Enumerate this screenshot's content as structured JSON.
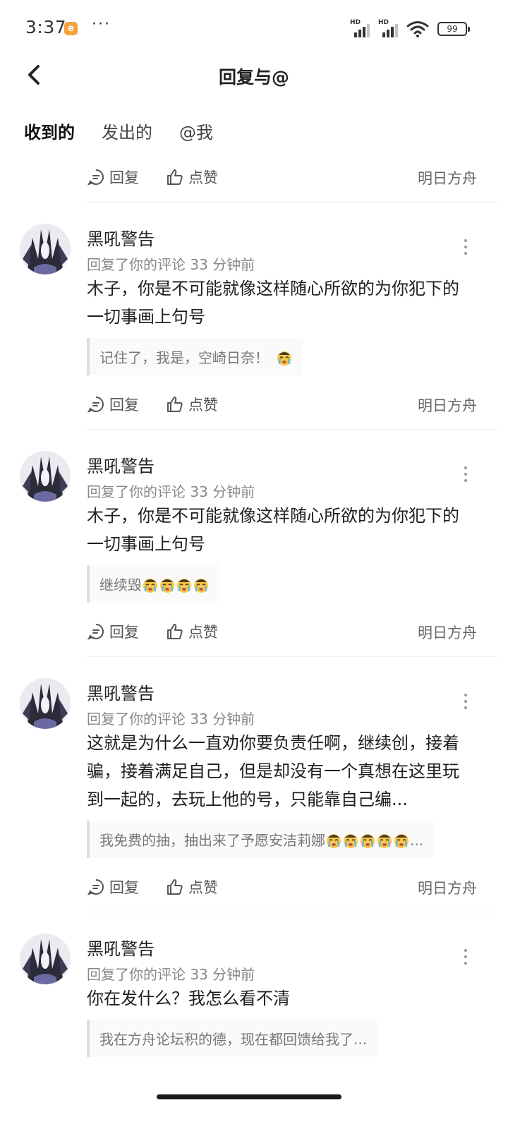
{
  "status_bar": {
    "time": "3:37",
    "app_badge": "e",
    "more": "···",
    "signal_1_label": "HD",
    "signal_2_label": "HD",
    "battery": "99"
  },
  "header": {
    "title": "回复与@"
  },
  "tabs": [
    {
      "label": "收到的",
      "active": true
    },
    {
      "label": "发出的",
      "active": false
    },
    {
      "label": "@我",
      "active": false
    }
  ],
  "top_actions": {
    "reply": "回复",
    "like": "点赞",
    "source": "明日方舟"
  },
  "items": [
    {
      "username": "黑吼警告",
      "meta": "回复了你的评论 33 分钟前",
      "text": "木子，你是不可能就像这样随心所欲的为你犯下的一切事画上句号",
      "quote": "记住了，我是，空崎日奈！",
      "quote_emoji_count": 1,
      "reply": "回复",
      "like": "点赞",
      "source": "明日方舟"
    },
    {
      "username": "黑吼警告",
      "meta": "回复了你的评论 33 分钟前",
      "text": "木子，你是不可能就像这样随心所欲的为你犯下的一切事画上句号",
      "quote": "继续毁",
      "quote_emoji_count": 4,
      "reply": "回复",
      "like": "点赞",
      "source": "明日方舟"
    },
    {
      "username": "黑吼警告",
      "meta": "回复了你的评论 33 分钟前",
      "text": "这就是为什么一直劝你要负责任啊，继续创，接着骗，接着满足自己，但是却没有一个真想在这里玩到一起的，去玩上他的号，只能靠自己编...",
      "quote": "我免费的抽，抽出来了予愿安洁莉娜",
      "quote_emoji_count": 5,
      "quote_suffix": "...",
      "reply": "回复",
      "like": "点赞",
      "source": "明日方舟"
    },
    {
      "username": "黑吼警告",
      "meta": "回复了你的评论 33 分钟前",
      "text": "你在发什么？我怎么看不清",
      "quote": "我在方舟论坛积的德，现在都回馈给我了...",
      "quote_emoji_count": 0
    }
  ],
  "colors": {
    "tab_underline": "#2ad6c3",
    "app_badge": "#f5a23c"
  }
}
